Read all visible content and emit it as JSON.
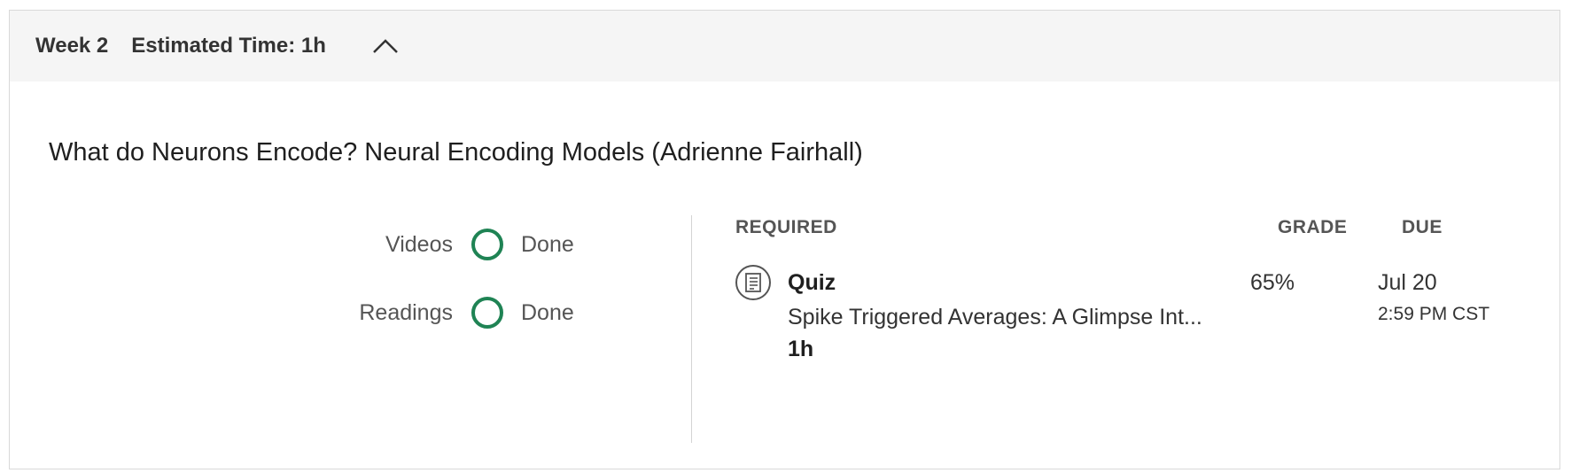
{
  "week": {
    "label": "Week 2",
    "estimated_time": "Estimated Time: 1h",
    "toggle_icon": "chevron-up-icon"
  },
  "module": {
    "title": "What do Neurons Encode? Neural Encoding Models (Adrienne Fairhall)"
  },
  "progress": [
    {
      "label": "Videos",
      "status": "Done"
    },
    {
      "label": "Readings",
      "status": "Done"
    }
  ],
  "table": {
    "headers": {
      "required": "REQUIRED",
      "grade": "GRADE",
      "due": "DUE"
    },
    "items": [
      {
        "icon": "quiz-document-icon",
        "type": "Quiz",
        "name": "Spike Triggered Averages: A Glimpse Int...",
        "duration": "1h",
        "grade": "65%",
        "due_date": "Jul 20",
        "due_time": "2:59 PM CST"
      }
    ]
  },
  "colors": {
    "accent_green": "#1f8354",
    "header_bg": "#f5f5f5",
    "border": "#d9d9d9"
  }
}
